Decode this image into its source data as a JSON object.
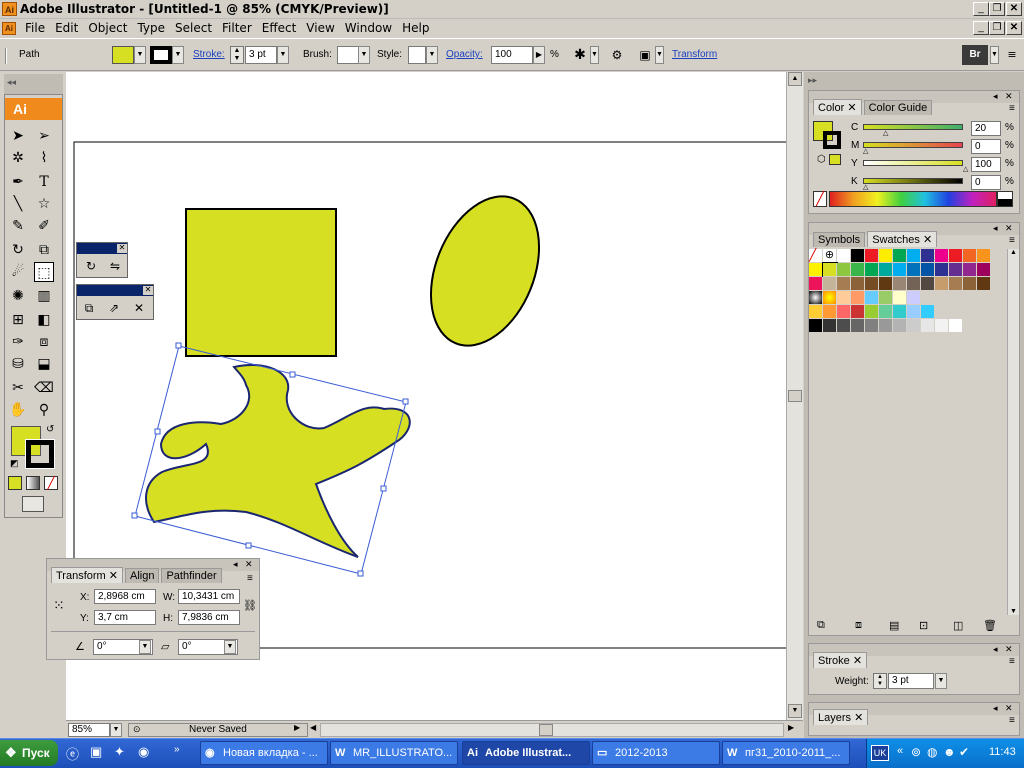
{
  "window": {
    "title": "Adobe Illustrator - [Untitled-1 @ 85% (CMYK/Preview)]"
  },
  "menu": [
    "File",
    "Edit",
    "Object",
    "Type",
    "Select",
    "Filter",
    "Effect",
    "View",
    "Window",
    "Help"
  ],
  "control": {
    "selection_type": "Path",
    "stroke_label": "Stroke:",
    "stroke_value": "3 pt",
    "brush_label": "Brush:",
    "style_label": "Style:",
    "opacity_label": "Opacity:",
    "opacity_value": "100",
    "opacity_unit": "%",
    "transform_link": "Transform",
    "bridge": "Br"
  },
  "colors": {
    "fill": "#d6df22",
    "stroke": "#000000"
  },
  "color_panel": {
    "tabs": [
      "Color",
      "Color Guide"
    ],
    "channels": [
      {
        "name": "C",
        "value": "20"
      },
      {
        "name": "M",
        "value": "0"
      },
      {
        "name": "Y",
        "value": "100"
      },
      {
        "name": "K",
        "value": "0"
      }
    ],
    "unit": "%"
  },
  "swatches_panel": {
    "tabs": [
      "Symbols",
      "Swatches"
    ]
  },
  "stroke_panel": {
    "tab": "Stroke",
    "weight_label": "Weight:",
    "weight_value": "3 pt"
  },
  "layers_panel": {
    "tab": "Layers"
  },
  "transform_panel": {
    "tabs": [
      "Transform",
      "Align",
      "Pathfinder"
    ],
    "x_label": "X:",
    "x": "2,8968 cm",
    "y_label": "Y:",
    "y": "3,7 cm",
    "w_label": "W:",
    "w": "10,3431 cm",
    "h_label": "H:",
    "h": "7,9836 cm",
    "rotate": "0°",
    "shear": "0°"
  },
  "status": {
    "zoom": "85%",
    "save_state": "Never Saved"
  },
  "taskbar": {
    "start": "Пуск",
    "items": [
      {
        "label": "Новая вкладка - ...",
        "active": false
      },
      {
        "label": "MR_ILLUSTRATO...",
        "active": false
      },
      {
        "label": "Adobe Illustrat...",
        "active": true
      },
      {
        "label": "2012-2013",
        "active": false
      },
      {
        "label": "пг31_2010-2011_...",
        "active": false
      }
    ],
    "lang": "UK",
    "clock": "11:43"
  }
}
